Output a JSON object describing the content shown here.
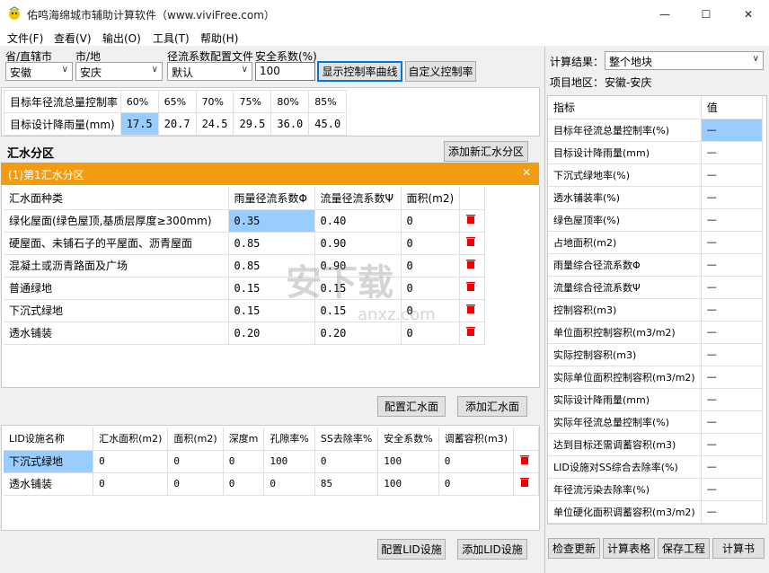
{
  "app": {
    "title": "佑鸣海绵城市辅助计算软件（www.viviFree.com）"
  },
  "window": {
    "minimize": "—",
    "maximize": "☐",
    "close": "✕"
  },
  "menu": [
    "文件(F)",
    "查看(V)",
    "输出(O)",
    "工具(T)",
    "帮助(H)"
  ],
  "top": {
    "province_label": "省/直辖市",
    "province_value": "安徽",
    "city_label": "市/地",
    "city_value": "安庆",
    "config_label": "径流系数配置文件",
    "config_value": "默认",
    "safety_label": "安全系数(%)",
    "safety_value": "100",
    "show_curve": "显示控制率曲线",
    "custom_rate": "自定义控制率"
  },
  "targets": {
    "rate_label": "目标年径流总量控制率",
    "rates": [
      "60%",
      "65%",
      "70%",
      "75%",
      "80%",
      "85%"
    ],
    "rain_label": "目标设计降雨量(mm)",
    "rains": [
      "17.5",
      "20.7",
      "24.5",
      "29.5",
      "36.0",
      "45.0"
    ]
  },
  "zone": {
    "title": "汇水分区",
    "add_button": "添加新汇水分区",
    "name": "(1)第1汇水分区",
    "close": "✕"
  },
  "surface": {
    "headers": [
      "汇水面种类",
      "雨量径流系数Φ",
      "流量径流系数Ψ",
      "面积(m2)"
    ],
    "rows": [
      {
        "type": "绿化屋面(绿色屋顶,基质层厚度≥300mm)",
        "phi": "0.35",
        "psi": "0.40",
        "area": "0"
      },
      {
        "type": "硬屋面、未铺石子的平屋面、沥青屋面",
        "phi": "0.85",
        "psi": "0.90",
        "area": "0"
      },
      {
        "type": "混凝土或沥青路面及广场",
        "phi": "0.85",
        "psi": "0.90",
        "area": "0"
      },
      {
        "type": "普通绿地",
        "phi": "0.15",
        "psi": "0.15",
        "area": "0"
      },
      {
        "type": "下沉式绿地",
        "phi": "0.15",
        "psi": "0.15",
        "area": "0"
      },
      {
        "type": "透水铺装",
        "phi": "0.20",
        "psi": "0.20",
        "area": "0"
      }
    ],
    "config_button": "配置汇水面",
    "add_button": "添加汇水面"
  },
  "lid": {
    "headers": [
      "LID设施名称",
      "汇水面积(m2)",
      "面积(m2)",
      "深度m",
      "孔隙率%",
      "SS去除率%",
      "安全系数%",
      "调蓄容积(m3)"
    ],
    "rows": [
      [
        "下沉式绿地",
        "0",
        "0",
        "0",
        "100",
        "0",
        "100",
        "0"
      ],
      [
        "透水铺装",
        "0",
        "0",
        "0",
        "0",
        "85",
        "100",
        "0"
      ]
    ],
    "config_button": "配置LID设施",
    "add_button": "添加LID设施"
  },
  "right": {
    "result_label": "计算结果：",
    "result_value": "整个地块",
    "area_label": "项目地区：",
    "area_value": "安徽-安庆",
    "headers": [
      "指标",
      "值"
    ],
    "rows": [
      [
        "目标年径流总量控制率(%)",
        "—"
      ],
      [
        "目标设计降雨量(mm)",
        "—"
      ],
      [
        "下沉式绿地率(%)",
        "—"
      ],
      [
        "透水铺装率(%)",
        "—"
      ],
      [
        "绿色屋顶率(%)",
        "—"
      ],
      [
        "占地面积(m2)",
        "—"
      ],
      [
        "雨量综合径流系数Φ",
        "—"
      ],
      [
        "流量综合径流系数Ψ",
        "—"
      ],
      [
        "控制容积(m3)",
        "—"
      ],
      [
        "单位面积控制容积(m3/m2)",
        "—"
      ],
      [
        "实际控制容积(m3)",
        "—"
      ],
      [
        "实际单位面积控制容积(m3/m2)",
        "—"
      ],
      [
        "实际设计降雨量(mm)",
        "—"
      ],
      [
        "实际年径流总量控制率(%)",
        "—"
      ],
      [
        "达到目标还需调蓄容积(m3)",
        "—"
      ],
      [
        "LID设施对SS综合去除率(%)",
        "—"
      ],
      [
        "年径流污染去除率(%)",
        "—"
      ],
      [
        "单位硬化面积调蓄容积(m3/m2)",
        "—"
      ]
    ],
    "buttons": [
      "检查更新",
      "计算表格",
      "保存工程",
      "计算书"
    ]
  },
  "watermark": {
    "text": "安下载",
    "sub": "anxz.com"
  }
}
